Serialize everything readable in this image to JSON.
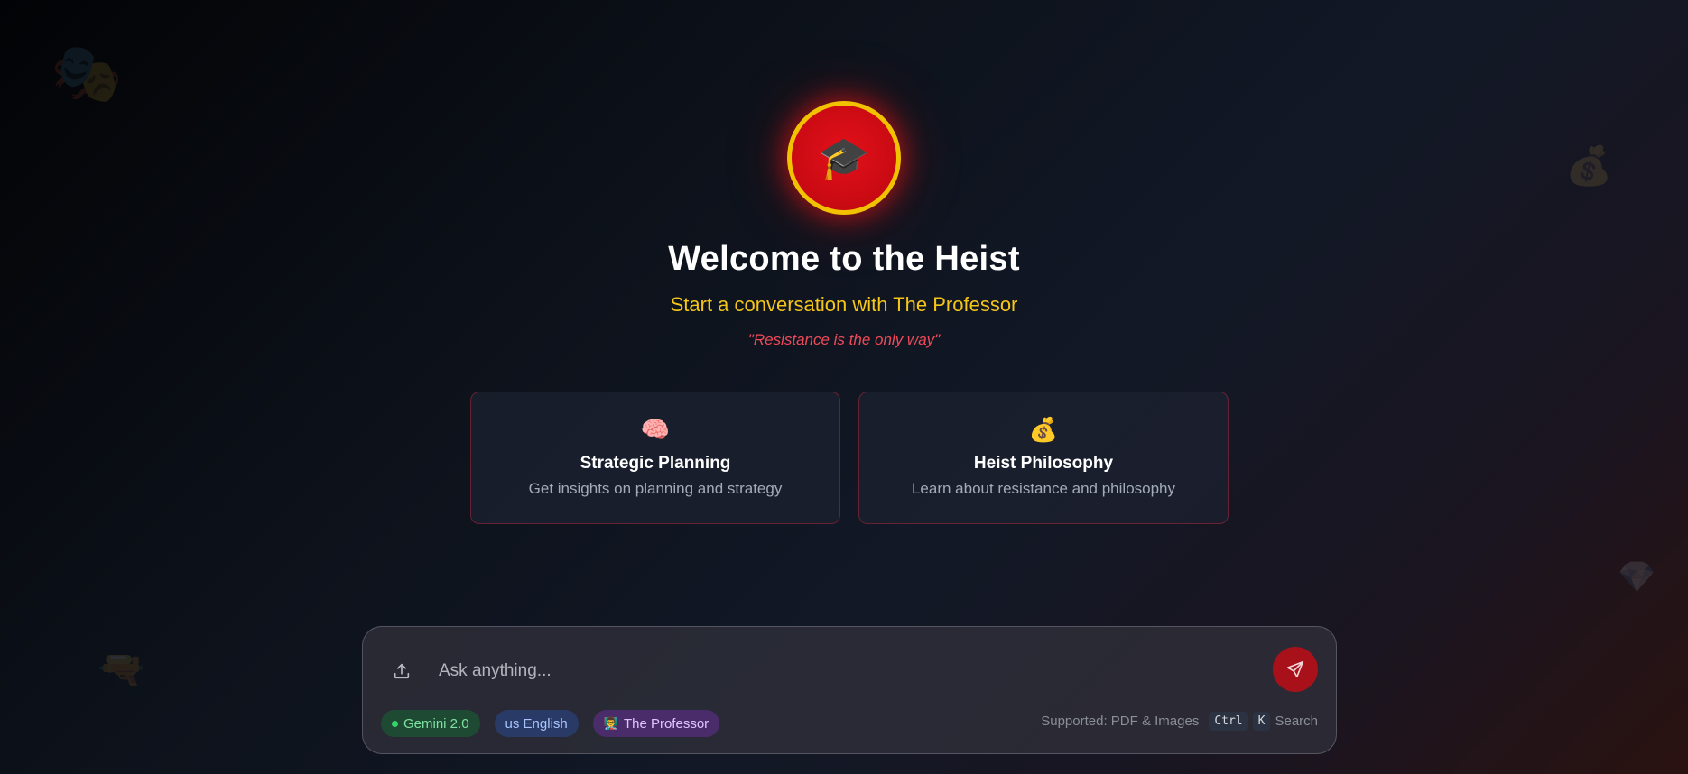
{
  "background_icons": [
    {
      "name": "theater-masks-icon",
      "glyph": "🎭"
    },
    {
      "name": "money-bag-icon",
      "glyph": "💰"
    },
    {
      "name": "gem-icon",
      "glyph": "💎"
    },
    {
      "name": "gun-icon",
      "glyph": "🔫"
    }
  ],
  "hero": {
    "avatar_icon": "🎓",
    "title": "Welcome to the Heist",
    "subtitle": "Start a conversation with The Professor",
    "quote": "\"Resistance is the only way\""
  },
  "cards": [
    {
      "icon": "🧠",
      "title": "Strategic Planning",
      "description": "Get insights on planning and strategy"
    },
    {
      "icon": "💰",
      "title": "Heist Philosophy",
      "description": "Learn about resistance and philosophy"
    }
  ],
  "composer": {
    "placeholder": "Ask anything...",
    "value": "",
    "badges": {
      "model": "Gemini 2.0",
      "language": "us English",
      "persona_icon": "👨‍🏫",
      "persona": "The Professor"
    },
    "supported": "Supported: PDF & Images",
    "shortcut_keys": [
      "Ctrl",
      "K"
    ],
    "shortcut_label": "Search"
  },
  "colors": {
    "accent_red": "#c80a12",
    "accent_gold": "#f2c200",
    "subtitle_yellow": "#f5c518",
    "quote_red": "#f04a5a"
  }
}
